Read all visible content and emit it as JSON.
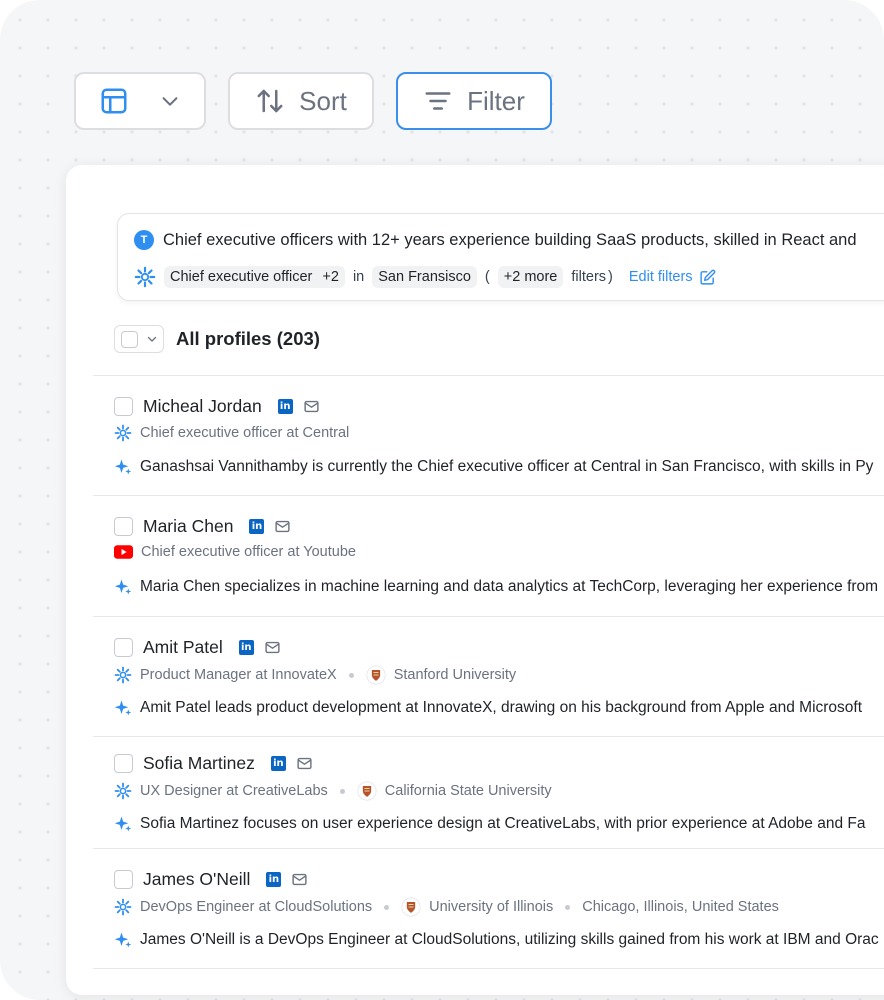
{
  "toolbar": {
    "sort_label": "Sort",
    "filter_label": "Filter"
  },
  "query": {
    "badge": "T",
    "text": "Chief executive officers with 12+ years experience building SaaS products, skilled in React and",
    "role_chip": "Chief executive officer",
    "role_more": "+2",
    "in_text": "in",
    "location_chip": "San Fransisco",
    "open_paren": "(",
    "more_chip": "+2 more",
    "filters_text": "filters",
    "close_paren": ")",
    "edit_label": "Edit filters"
  },
  "list_header": {
    "title": "All profiles (203)"
  },
  "profiles": [
    {
      "name": "Micheal Jordan",
      "role": "Chief executive officer at Central",
      "school": "",
      "location": "",
      "summary": "Ganashsai Vannithamby is currently the Chief executive officer at Central in San Francisco, with skills in Py"
    },
    {
      "name": "Maria Chen",
      "role": "Chief executive officer at Youtube",
      "school": "",
      "location": "",
      "summary": "Maria Chen specializes in machine learning and data analytics at TechCorp, leveraging her experience from"
    },
    {
      "name": "Amit Patel",
      "role": "Product Manager at InnovateX",
      "school": "Stanford University",
      "location": "",
      "summary": "Amit Patel leads product development at InnovateX, drawing on his background from Apple and Microsoft"
    },
    {
      "name": "Sofia Martinez",
      "role": "UX Designer at CreativeLabs",
      "school": "California State University",
      "location": "",
      "summary": "Sofia Martinez focuses on user experience design at CreativeLabs, with prior experience at Adobe and Fa"
    },
    {
      "name": "James O'Neill",
      "role": "DevOps Engineer at CloudSolutions",
      "school": "University of Illinois",
      "location": "Chicago, Illinois, United States",
      "summary": "James O'Neill is a DevOps Engineer at CloudSolutions, utilizing skills gained from his work at IBM and Orac"
    }
  ],
  "icons": {
    "linkedin": "linkedin-icon",
    "mail": "mail-icon",
    "company_central": "central-logo-icon",
    "company_youtube": "youtube-logo-icon",
    "school": "university-crest-icon",
    "ai_summary": "sparkle-icon"
  },
  "colors": {
    "accent": "#2f8ff0",
    "linkedin": "#0a66c2",
    "youtube": "#ff0000"
  }
}
